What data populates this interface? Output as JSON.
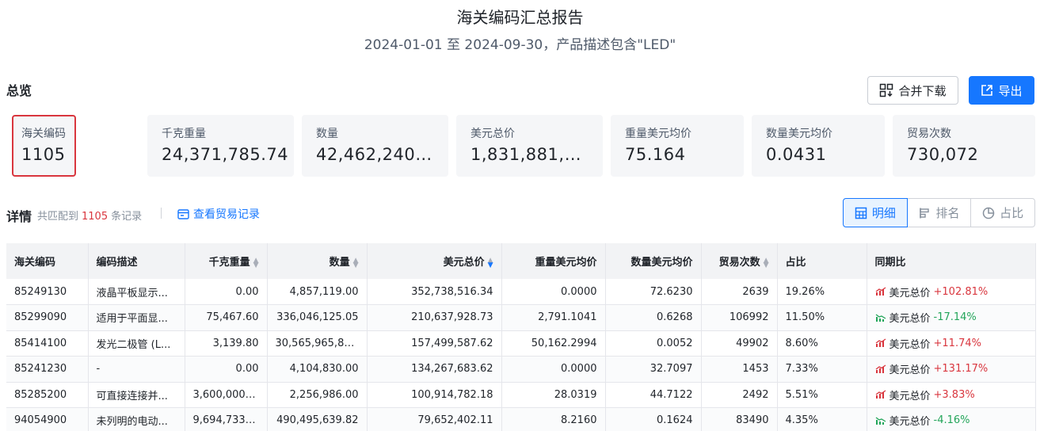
{
  "header": {
    "title": "海关编码汇总报告",
    "subtitle": "2024-01-01 至 2024-09-30，产品描述包含\"LED\""
  },
  "overview": {
    "label": "总览",
    "merge_download": "合并下载",
    "export": "导出",
    "cards": [
      {
        "label": "海关编码",
        "value": "1105"
      },
      {
        "label": "千克重量",
        "value": "24,371,785.74"
      },
      {
        "label": "数量",
        "value": "42,462,240,..."
      },
      {
        "label": "美元总价",
        "value": "1,831,881,2..."
      },
      {
        "label": "重量美元均价",
        "value": "75.164"
      },
      {
        "label": "数量美元均价",
        "value": "0.0431"
      },
      {
        "label": "贸易次数",
        "value": "730,072"
      }
    ]
  },
  "details": {
    "label": "详情",
    "match_prefix": "共匹配到",
    "match_count": "1105",
    "match_suffix": "条记录",
    "trade_link": "查看贸易记录",
    "view_tabs": [
      {
        "label": "明细",
        "icon": "table-icon",
        "active": true
      },
      {
        "label": "排名",
        "icon": "ranking-icon",
        "active": false
      },
      {
        "label": "占比",
        "icon": "pie-icon",
        "active": false
      }
    ]
  },
  "table": {
    "columns": [
      "海关编码",
      "编码描述",
      "千克重量",
      "数量",
      "美元总价",
      "重量美元均价",
      "数量美元均价",
      "贸易次数",
      "占比",
      "同期比"
    ],
    "rows": [
      {
        "code": "85249130",
        "desc": "液晶平板显示...",
        "kg": "0.00",
        "qty": "4,857,119.00",
        "usd": "352,738,516.34",
        "kg_avg": "0.0000",
        "qty_avg": "72.6230",
        "trades": "2639",
        "share": "19.26%",
        "yoy_label": "美元总价",
        "yoy": "+102.81%",
        "yoy_dir": "up"
      },
      {
        "code": "85299090",
        "desc": "适用于平面显...",
        "kg": "75,467.60",
        "qty": "336,046,125.05",
        "usd": "210,637,928.73",
        "kg_avg": "2,791.1041",
        "qty_avg": "0.6268",
        "trades": "106992",
        "share": "11.50%",
        "yoy_label": "美元总价",
        "yoy": "-17.14%",
        "yoy_dir": "down"
      },
      {
        "code": "85414100",
        "desc": "发光二极管 (L...",
        "kg": "3,139.80",
        "qty": "30,565,965,80...",
        "usd": "157,499,587.62",
        "kg_avg": "50,162.2994",
        "qty_avg": "0.0052",
        "trades": "49902",
        "share": "8.60%",
        "yoy_label": "美元总价",
        "yoy": "+11.74%",
        "yoy_dir": "up"
      },
      {
        "code": "85241230",
        "desc": "-",
        "kg": "0.00",
        "qty": "4,104,830.00",
        "usd": "134,267,683.62",
        "kg_avg": "0.0000",
        "qty_avg": "32.7097",
        "trades": "1453",
        "share": "7.33%",
        "yoy_label": "美元总价",
        "yoy": "+131.17%",
        "yoy_dir": "up"
      },
      {
        "code": "85285200",
        "desc": "可直接连接并...",
        "kg": "3,600,000.00",
        "qty": "2,256,986.00",
        "usd": "100,914,782.18",
        "kg_avg": "28.0319",
        "qty_avg": "44.7122",
        "trades": "2492",
        "share": "5.51%",
        "yoy_label": "美元总价",
        "yoy": "+3.83%",
        "yoy_dir": "up"
      },
      {
        "code": "94054900",
        "desc": "未列明的电动...",
        "kg": "9,694,733.96",
        "qty": "490,495,639.82",
        "usd": "79,652,402.11",
        "kg_avg": "8.2160",
        "qty_avg": "0.1624",
        "trades": "83490",
        "share": "4.35%",
        "yoy_label": "美元总价",
        "yoy": "-4.16%",
        "yoy_dir": "down"
      }
    ]
  },
  "colors": {
    "accent": "#1677ff",
    "up": "#d9363e",
    "down": "#23a55a",
    "highlight": "#d9363e"
  }
}
